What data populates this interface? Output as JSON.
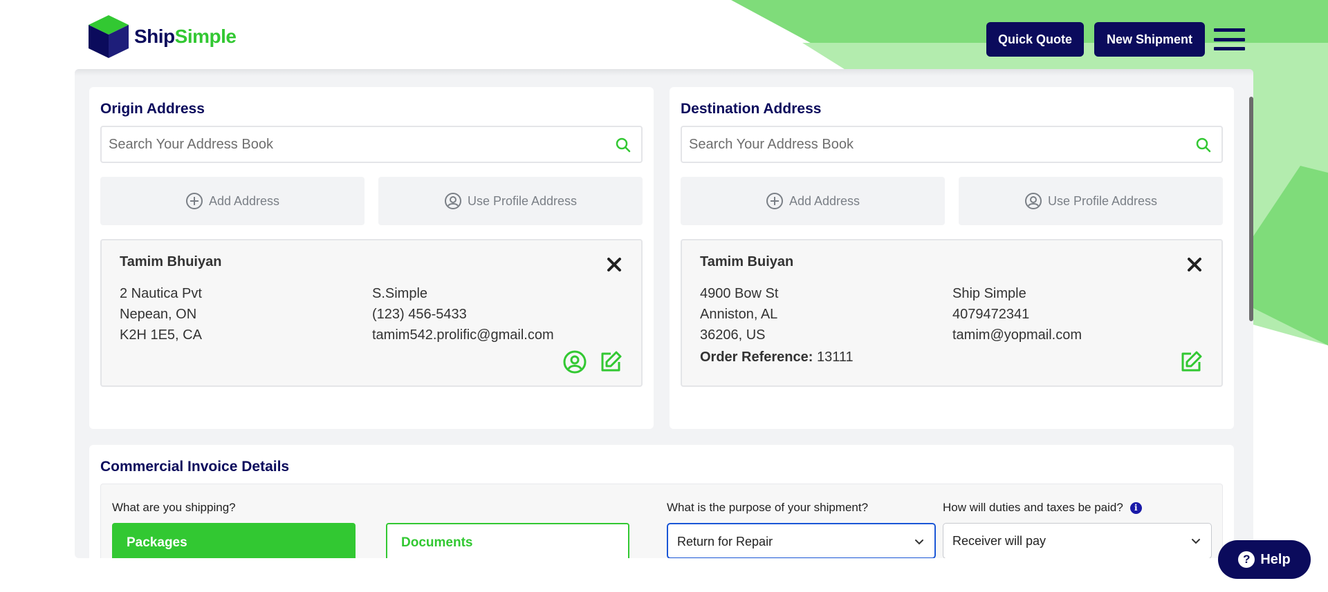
{
  "header": {
    "logo": {
      "ship": "Ship",
      "simple": "Simple"
    },
    "quick_quote_label": "Quick Quote",
    "new_shipment_label": "New Shipment"
  },
  "origin": {
    "title": "Origin Address",
    "search_placeholder": "Search Your Address Book",
    "add_address_label": "Add Address",
    "use_profile_label": "Use Profile Address",
    "contact": {
      "name": "Tamim Bhuiyan",
      "street": "2 Nautica Pvt",
      "city": "Nepean, ON",
      "postal": "K2H 1E5, CA",
      "company": "S.Simple",
      "phone": "(123) 456-5433",
      "email": "tamim542.prolific@gmail.com"
    }
  },
  "destination": {
    "title": "Destination Address",
    "search_placeholder": "Search Your Address Book",
    "add_address_label": "Add Address",
    "use_profile_label": "Use Profile Address",
    "contact": {
      "name": "Tamim Buiyan",
      "street": "4900 Bow St",
      "city": "Anniston, AL",
      "postal": "36206, US",
      "company": "Ship Simple",
      "phone": "4079472341",
      "email": "tamim@yopmail.com",
      "order_reference_label": "Order Reference:",
      "order_reference_value": "13111"
    }
  },
  "invoice": {
    "title": "Commercial Invoice Details",
    "shipping_question": "What are you shipping?",
    "options": [
      "Packages",
      "Documents"
    ],
    "selected_option": "Packages",
    "purpose_question": "What is the purpose of your shipment?",
    "purpose_value": "Return for Repair",
    "duties_question": "How will duties and taxes be paid?",
    "duties_value": "Receiver will pay"
  },
  "help_label": "Help",
  "colors": {
    "navy": "#0b0b5c",
    "green": "#32c832",
    "light_green": "#b3ecae",
    "mid_green": "#7fdc7a",
    "panel_bg": "#f2f3f5",
    "focus_blue": "#1a56d6"
  },
  "icons": [
    "logo-cube-icon",
    "menu-icon",
    "search-icon",
    "plus-circle-icon",
    "user-circle-icon",
    "close-icon",
    "edit-icon",
    "chevron-down-icon",
    "info-icon",
    "help-icon"
  ]
}
